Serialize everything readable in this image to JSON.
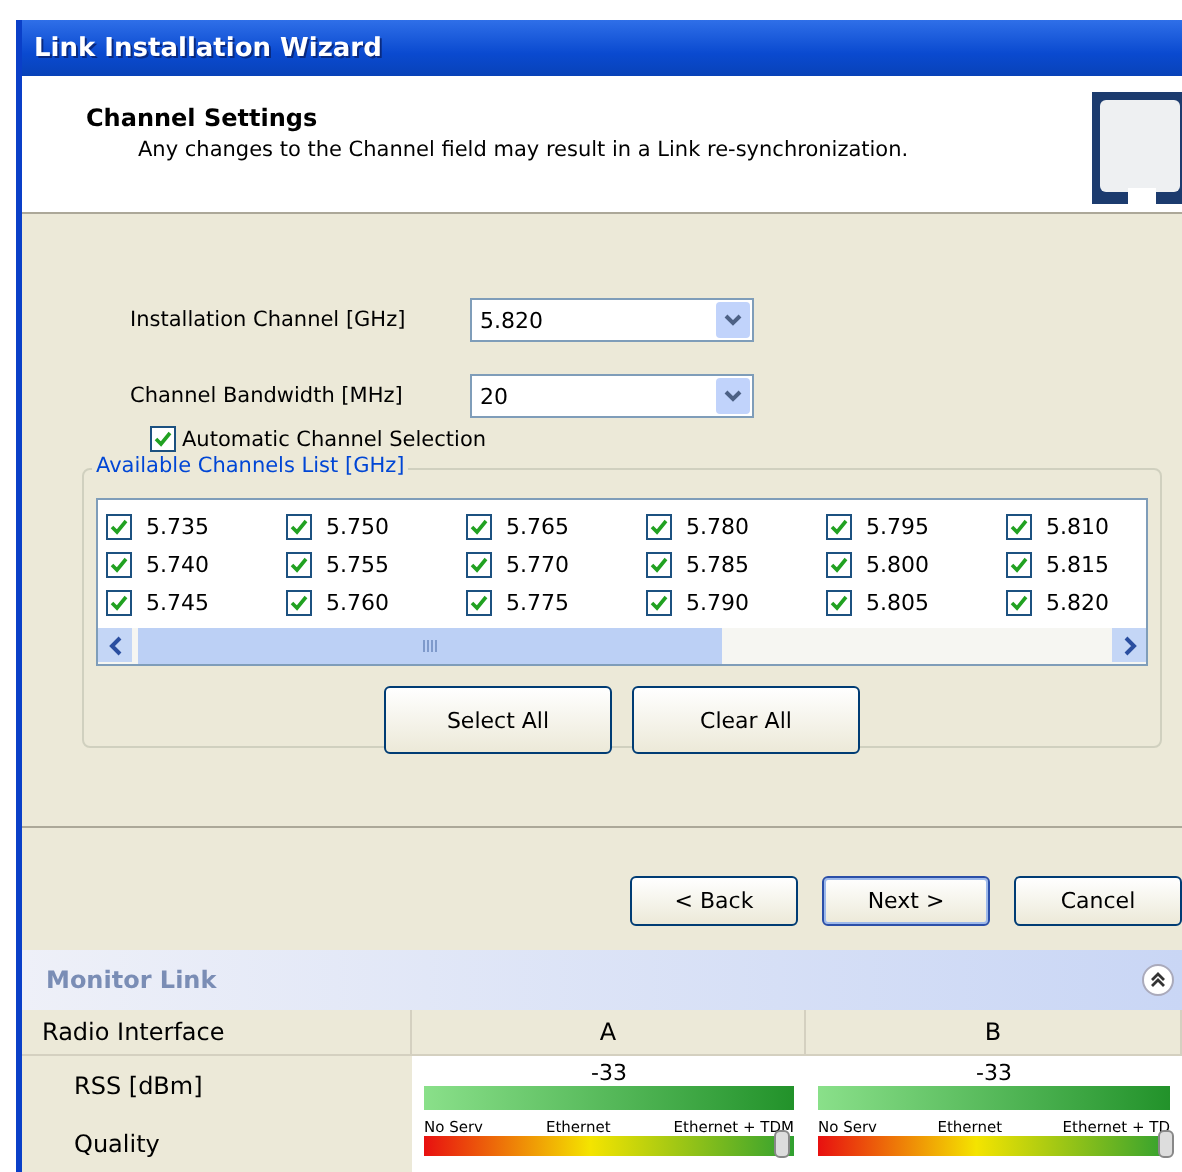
{
  "window": {
    "title": "Link Installation Wizard"
  },
  "header": {
    "title": "Channel Settings",
    "subtitle": "Any changes to the Channel field may result in a Link re-synchronization."
  },
  "fields": [
    {
      "label": "Installation Channel [GHz]",
      "value": "5.820"
    },
    {
      "label": "Channel Bandwidth [MHz]",
      "value": "20"
    }
  ],
  "auto_channel": {
    "label": "Automatic Channel Selection",
    "checked": true
  },
  "channels_group": {
    "title": "Available Channels List [GHz]",
    "channels": [
      {
        "label": "5.735",
        "checked": true
      },
      {
        "label": "5.740",
        "checked": true
      },
      {
        "label": "5.745",
        "checked": true
      },
      {
        "label": "5.750",
        "checked": true
      },
      {
        "label": "5.755",
        "checked": true
      },
      {
        "label": "5.760",
        "checked": true
      },
      {
        "label": "5.765",
        "checked": true
      },
      {
        "label": "5.770",
        "checked": true
      },
      {
        "label": "5.775",
        "checked": true
      },
      {
        "label": "5.780",
        "checked": true
      },
      {
        "label": "5.785",
        "checked": true
      },
      {
        "label": "5.790",
        "checked": true
      },
      {
        "label": "5.795",
        "checked": true
      },
      {
        "label": "5.800",
        "checked": true
      },
      {
        "label": "5.805",
        "checked": true
      },
      {
        "label": "5.810",
        "checked": true
      },
      {
        "label": "5.815",
        "checked": true
      },
      {
        "label": "5.820",
        "checked": true
      }
    ],
    "buttons": [
      "Select All",
      "Clear All"
    ]
  },
  "nav_buttons": [
    {
      "label": "< Back",
      "default": false
    },
    {
      "label": "Next >",
      "default": true
    },
    {
      "label": "Cancel",
      "default": false
    }
  ],
  "monitor": {
    "title": "Monitor Link",
    "header": {
      "label": "Radio Interface",
      "columns": [
        "A",
        "B"
      ]
    },
    "rss": {
      "label": "RSS [dBm]",
      "values": [
        {
          "reading": "-33",
          "level": 1
        },
        {
          "reading": "-33",
          "level": 1
        }
      ]
    },
    "quality": {
      "label": "Quality",
      "values": [
        {
          "scale": [
            "No Serv",
            "Ethernet",
            "Ethernet + TDM"
          ],
          "level": 0.97
        },
        {
          "scale": [
            "No Serv",
            "Ethernet",
            "Ethernet + TD"
          ],
          "level": 0.99
        }
      ]
    }
  }
}
